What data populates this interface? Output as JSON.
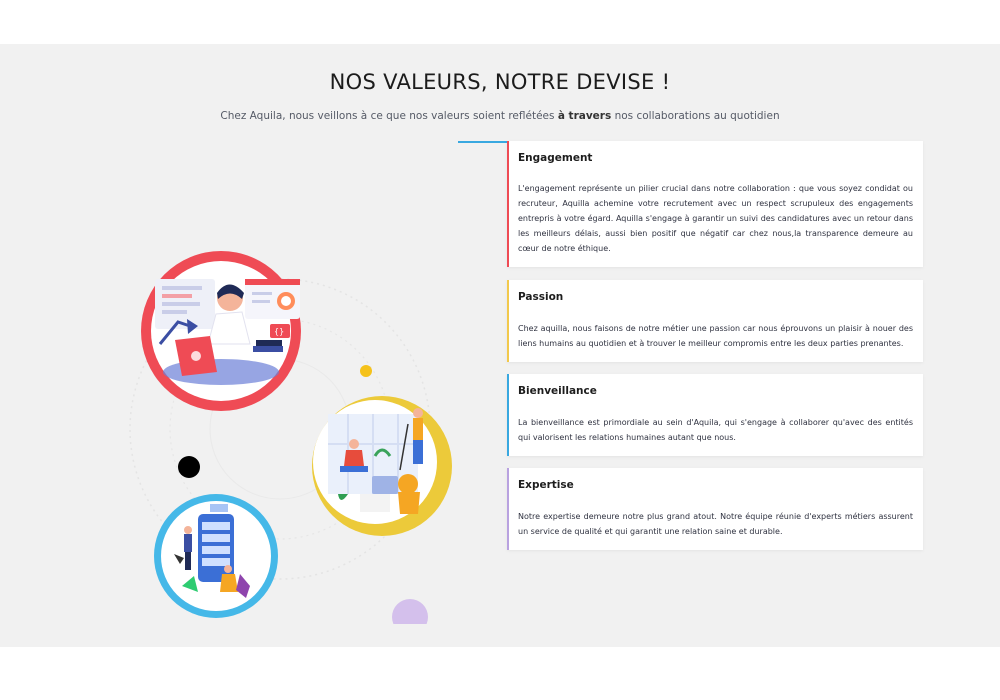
{
  "header": {
    "title": "NOS VALEURS, NOTRE DEVISE !",
    "subtitle_before": "Chez Aquila, nous veillons à ce que nos valeurs soient reflétées",
    "subtitle_bold": "à travers",
    "subtitle_after": "nos collaborations au quotidien"
  },
  "colors": {
    "accent_divider": "#39a8e0",
    "engagement_bar": "#ef4b55",
    "passion_bar": "#f2c94c",
    "bienveillance_bar": "#39a8e0",
    "expertise_bar": "#b9a2e0"
  },
  "illustration": {
    "icons": [
      "developer-at-laptop-illustration",
      "people-in-office-illustration",
      "team-with-mobile-app-illustration"
    ]
  },
  "values": [
    {
      "title": "Engagement",
      "text": "L'engagement représente un pilier crucial dans notre collaboration : que vous soyez condidat ou recruteur, Aquilla achemine votre recrutement avec un respect scrupuleux des engagements entrepris à votre égard. Aquilla s'engage à garantir un suivi des candidatures avec un retour dans les meilleurs délais, aussi bien positif que négatif car chez nous,la transparence demeure au cœur de notre éthique."
    },
    {
      "title": "Passion",
      "text": "Chez aquilla, nous faisons de notre métier une passion car nous éprouvons un plaisir à nouer des liens humains au quotidien et à trouver le meilleur compromis entre les deux parties prenantes."
    },
    {
      "title": "Bienveillance",
      "text": "La bienveillance est primordiale au sein d'Aquila, qui s'engage à collaborer qu'avec des entités qui valorisent les relations humaines autant que nous."
    },
    {
      "title": "Expertise",
      "text": "Notre expertise demeure notre plus grand atout. Notre équipe réunie d'experts métiers assurent un service de qualité et qui garantit une relation saine et durable."
    }
  ]
}
